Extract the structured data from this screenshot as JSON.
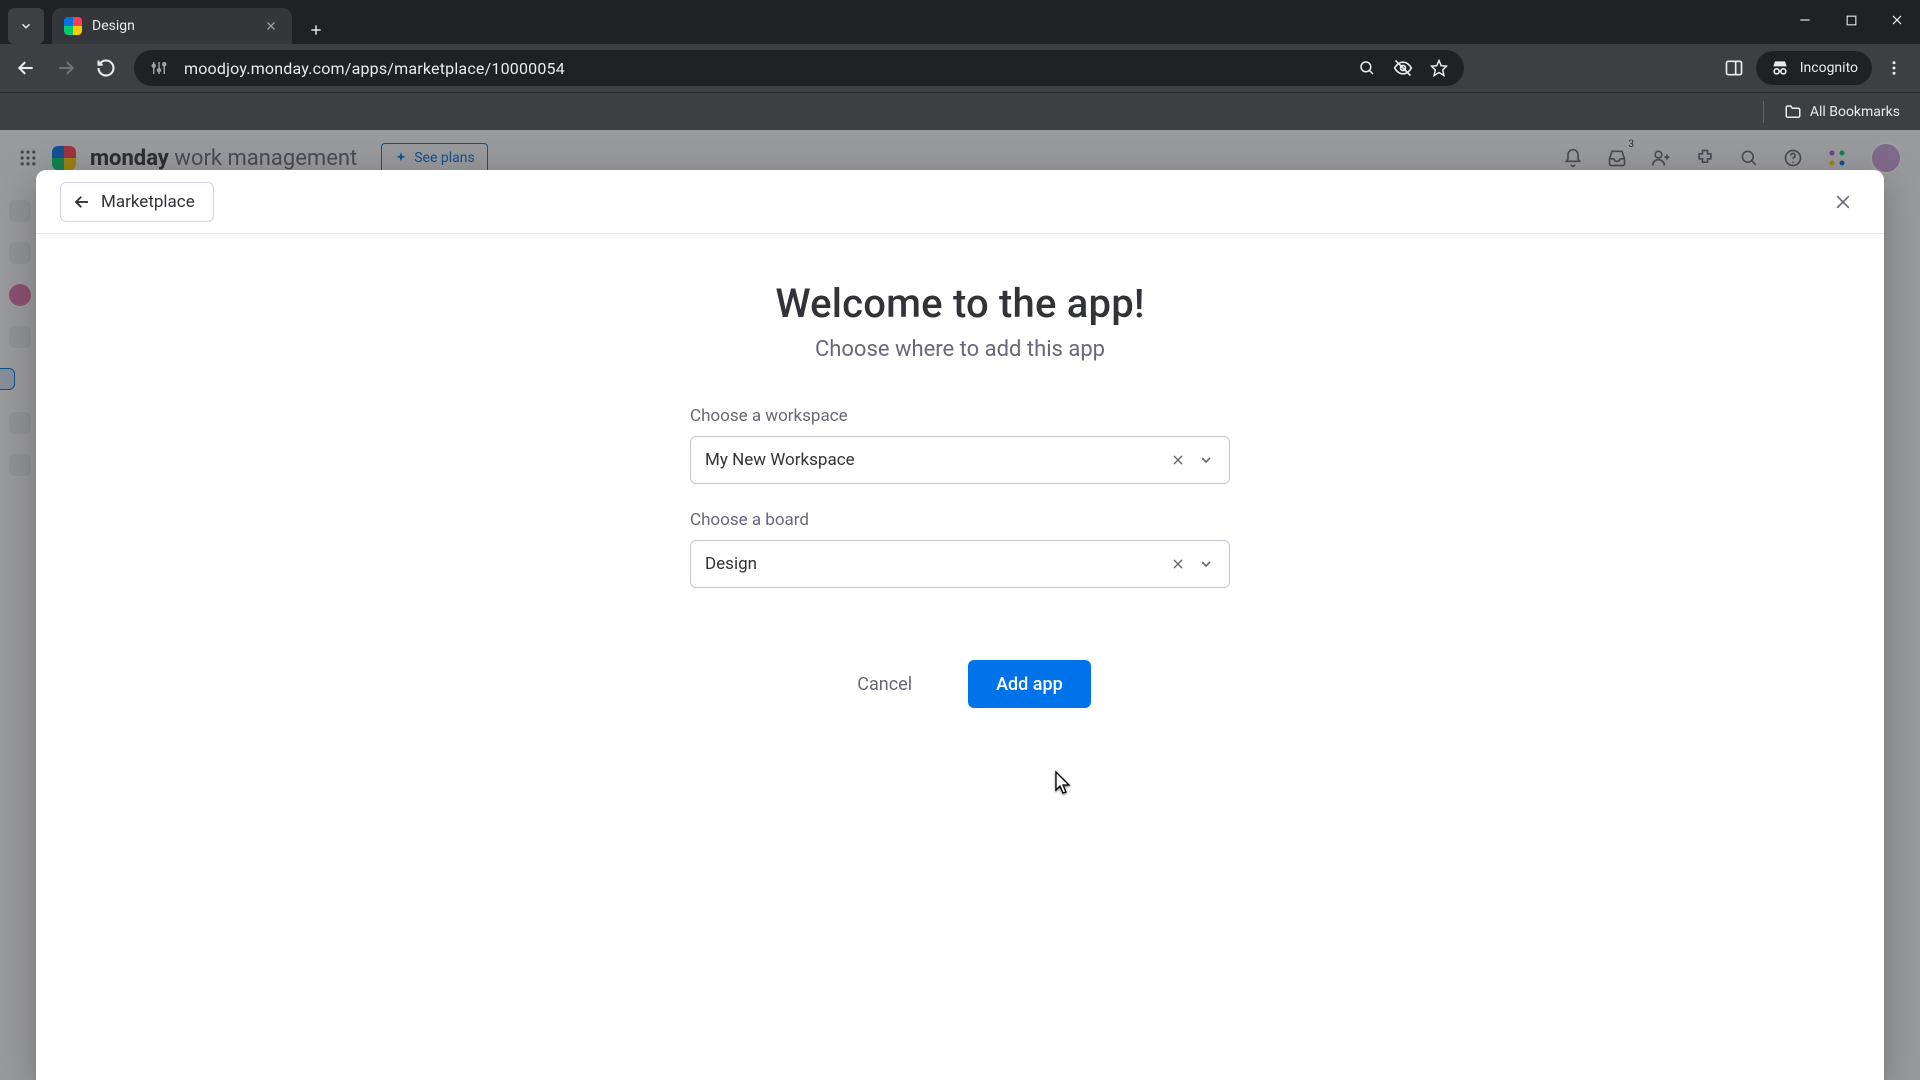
{
  "browser": {
    "tab_title": "Design",
    "url": "moodjoy.monday.com/apps/marketplace/10000054",
    "incognito_label": "Incognito",
    "all_bookmarks": "All Bookmarks"
  },
  "monday_header": {
    "brand_bold": "monday",
    "brand_light": "work management",
    "see_plans": "See plans",
    "notif_badge": "3"
  },
  "modal": {
    "back_label": "Marketplace",
    "title": "Welcome to the app!",
    "subtitle": "Choose where to add this app",
    "workspace_label": "Choose a workspace",
    "workspace_value": "My New Workspace",
    "board_label": "Choose a board",
    "board_value": "Design",
    "cancel": "Cancel",
    "add_app": "Add app"
  }
}
